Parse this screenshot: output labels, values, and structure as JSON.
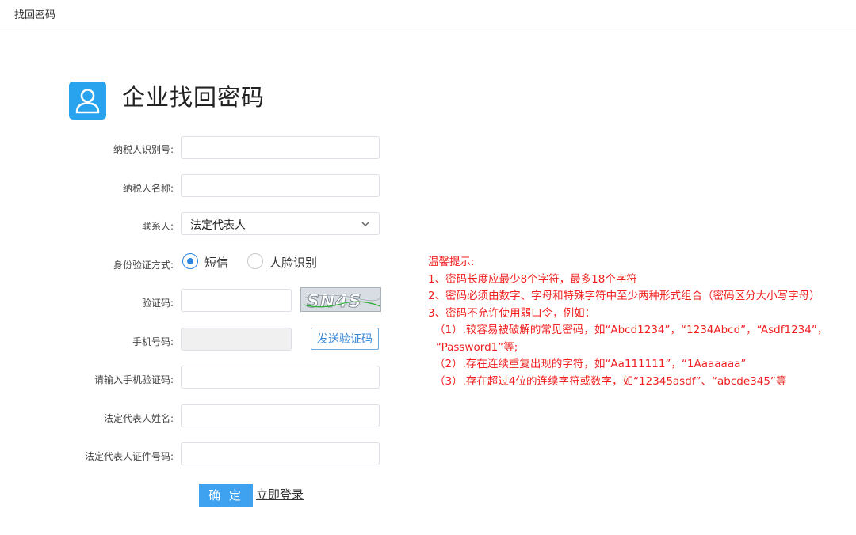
{
  "topbar": {
    "title": "找回密码"
  },
  "header": {
    "title": "企业找回密码",
    "icon": "user-icon",
    "icon_color": "#2aa3ee"
  },
  "form": {
    "taxpayer_id": {
      "label": "纳税人识别号:",
      "value": ""
    },
    "taxpayer_name": {
      "label": "纳税人名称:",
      "value": ""
    },
    "contact": {
      "label": "联系人:",
      "selected": "法定代表人"
    },
    "verify_method": {
      "label": "身份验证方式:",
      "options": [
        {
          "label": "短信",
          "checked": true
        },
        {
          "label": "人脸识别",
          "checked": false
        }
      ]
    },
    "captcha": {
      "label": "验证码:",
      "value": "",
      "image_text": "SN4S"
    },
    "phone": {
      "label": "手机号码:",
      "value": "",
      "send_code_label": "发送验证码"
    },
    "sms_code": {
      "label": "请输入手机验证码:",
      "value": ""
    },
    "legal_rep_name": {
      "label": "法定代表人姓名:",
      "value": ""
    },
    "legal_rep_id": {
      "label": "法定代表人证件号码:",
      "value": ""
    },
    "confirm_label": "确 定",
    "login_link": "立即登录"
  },
  "tips": {
    "title": "温馨提示:",
    "lines": [
      "1、密码长度应最少8个字符，最多18个字符",
      "2、密码必须由数字、字母和特殊字符中至少两种形式组合（密码区分大小写字母）",
      "3、密码不允许使用弱口令，例如：",
      "（1）.较容易被破解的常见密码，如“Abcd1234”，“1234Abcd”，“Asdf1234”，",
      "“Password1”等;",
      "（2）.存在连续重复出现的字符，如“Aa111111”，“1Aaaaaaa”",
      "（3）.存在超过4位的连续字符或数字，如“12345asdf”、“abcde345”等"
    ],
    "color": "#f02020"
  },
  "colors": {
    "accent": "#3ea2f1",
    "radio_active": "#2a86e0"
  }
}
